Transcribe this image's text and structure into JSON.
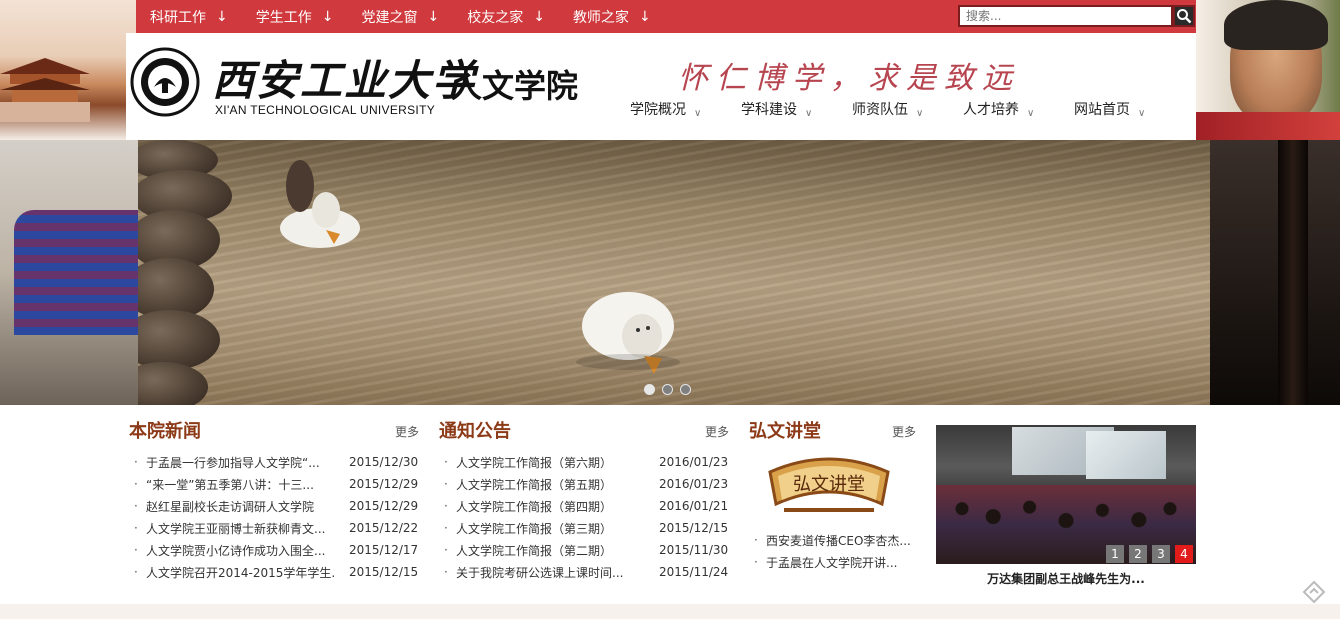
{
  "topbar": {
    "items": [
      {
        "label": "科研工作",
        "arrow": "↓"
      },
      {
        "label": "学生工作",
        "arrow": "↓"
      },
      {
        "label": "党建之窗",
        "arrow": "↓"
      },
      {
        "label": "校友之家",
        "arrow": "↓"
      },
      {
        "label": "教师之家",
        "arrow": "↓"
      }
    ],
    "search_placeholder": "搜索..."
  },
  "header": {
    "logo_cn": "西安工业大学",
    "logo_en": "XI'AN TECHNOLOGICAL UNIVERSITY",
    "college": "人文学院",
    "motto": "怀仁博学，求是致远"
  },
  "mainnav": [
    {
      "label": "学院概况",
      "chev": "∨"
    },
    {
      "label": "学科建设",
      "chev": "∨"
    },
    {
      "label": "师资队伍",
      "chev": "∨"
    },
    {
      "label": "人才培养",
      "chev": "∨"
    },
    {
      "label": "网站首页",
      "chev": "∨"
    }
  ],
  "banner": {
    "slides": 3,
    "active": 1
  },
  "news": {
    "title": "本院新闻",
    "more": "更多",
    "items": [
      {
        "text": "于孟晨一行参加指导人文学院“...",
        "date": "2015/12/30"
      },
      {
        "text": "“来一堂”第五季第八讲：十三...",
        "date": "2015/12/29"
      },
      {
        "text": "赵红星副校长走访调研人文学院",
        "date": "2015/12/29"
      },
      {
        "text": "人文学院王亚丽博士新获柳青文...",
        "date": "2015/12/22"
      },
      {
        "text": "人文学院贾小亿诗作成功入围全...",
        "date": "2015/12/17"
      },
      {
        "text": "人文学院召开2014-2015学年学生...",
        "date": "2015/12/15"
      }
    ]
  },
  "notices": {
    "title": "通知公告",
    "more": "更多",
    "items": [
      {
        "text": "人文学院工作简报（第六期）",
        "date": "2016/01/23"
      },
      {
        "text": "人文学院工作简报（第五期）",
        "date": "2016/01/23"
      },
      {
        "text": "人文学院工作简报（第四期）",
        "date": "2016/01/21"
      },
      {
        "text": "人文学院工作简报（第三期）",
        "date": "2015/12/15"
      },
      {
        "text": "人文学院工作简报（第二期）",
        "date": "2015/11/30"
      },
      {
        "text": "关于我院考研公选课上课时间...",
        "date": "2015/11/24"
      }
    ]
  },
  "lecture": {
    "title": "弘文讲堂",
    "more": "更多",
    "badge": "弘文讲堂",
    "items": [
      {
        "text": "西安麦道传播CEO李杏杰..."
      },
      {
        "text": "于孟晨在人文学院开讲..."
      }
    ]
  },
  "photo": {
    "pages": [
      "1",
      "2",
      "3",
      "4"
    ],
    "active_page": 4,
    "caption": "万达集团副总王战峰先生为..."
  },
  "colors": {
    "topbar": "#d0393d",
    "section_title": "#8c3a17",
    "motto": "#b7454f",
    "pager_active": "#e21b1b"
  }
}
